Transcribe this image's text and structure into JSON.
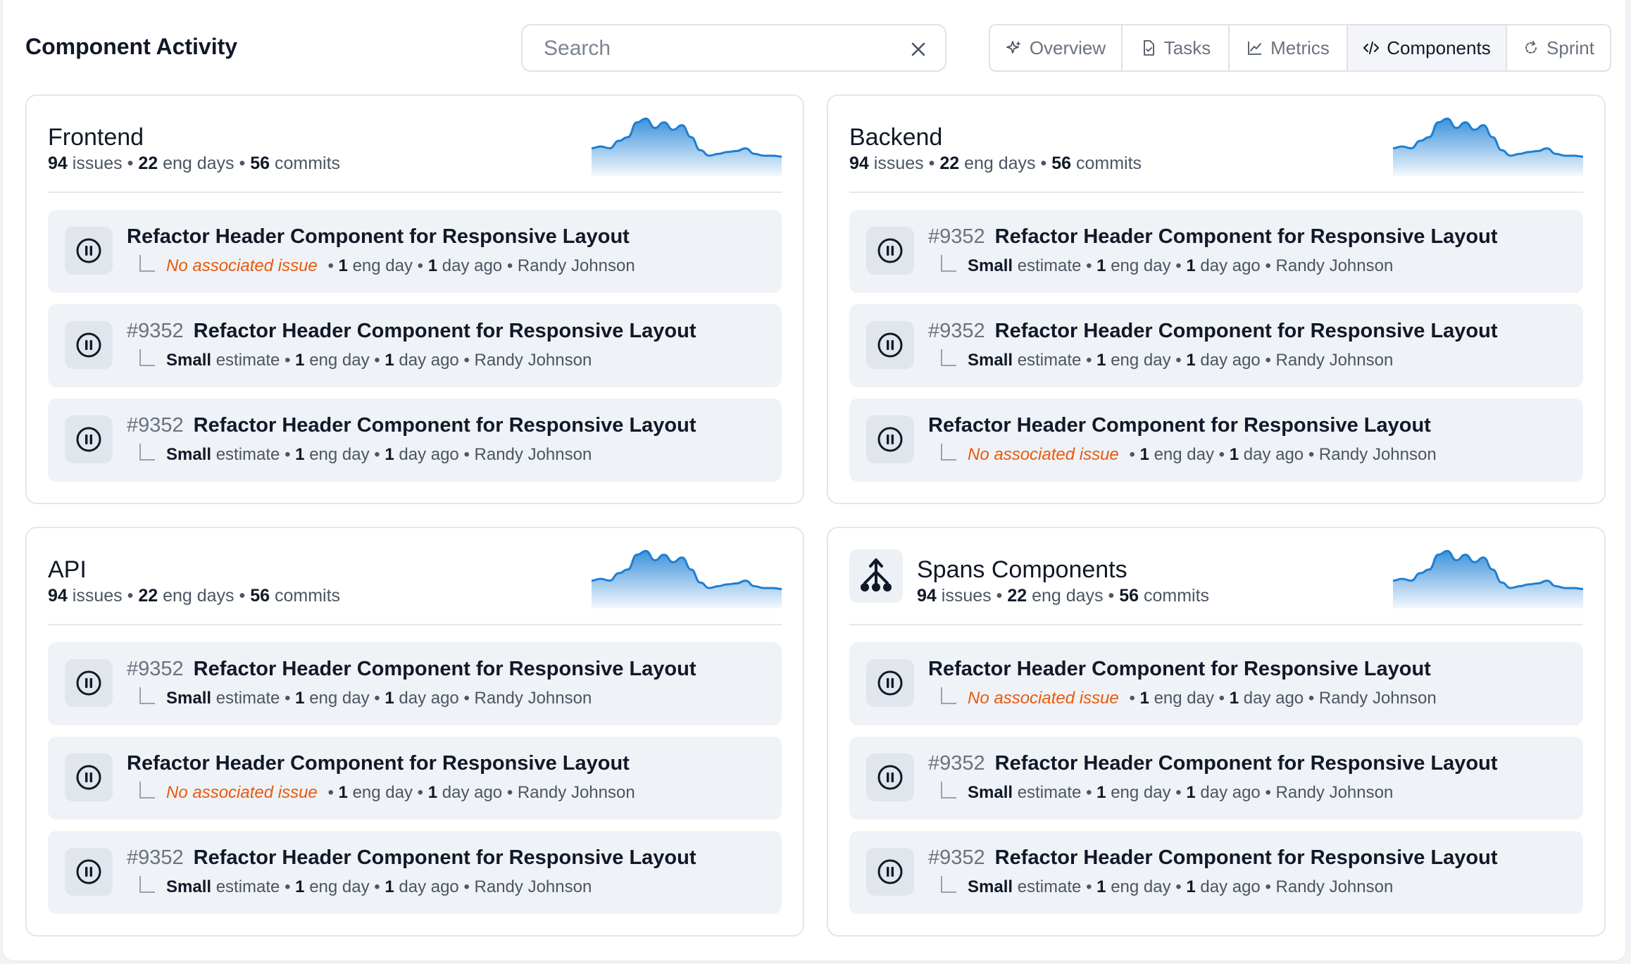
{
  "header": {
    "title": "Component Activity",
    "search_placeholder": "Search",
    "search_value": ""
  },
  "tabs": [
    {
      "label": "Overview",
      "icon": "sparkle-icon",
      "active": false
    },
    {
      "label": "Tasks",
      "icon": "document-icon",
      "active": false
    },
    {
      "label": "Metrics",
      "icon": "chart-line-icon",
      "active": false
    },
    {
      "label": "Components",
      "icon": "code-icon",
      "active": true
    },
    {
      "label": "Sprint",
      "icon": "cycle-icon",
      "active": false
    }
  ],
  "sep": "•",
  "labels": {
    "issues": "issues",
    "eng_days": "eng days",
    "commits": "commits",
    "estimate": "estimate",
    "eng_day": "eng day",
    "day_ago": "day ago",
    "no_issue": "No associated issue"
  },
  "colors": {
    "accent": "#1b7fd4",
    "warning": "#e8590c"
  },
  "sparkline": [
    30,
    32,
    30,
    38,
    42,
    58,
    62,
    52,
    58,
    50,
    55,
    42,
    28,
    22,
    24,
    26,
    27,
    30,
    24,
    22,
    22,
    21
  ],
  "cards": [
    {
      "name": "Frontend",
      "issues": "94",
      "eng_days": "22",
      "commits": "56",
      "items": [
        {
          "issue": "",
          "title": "Refactor Header Component for Responsive Layout",
          "estimate": "",
          "eng": "1",
          "ago": "1",
          "author": "Randy Johnson"
        },
        {
          "issue": "#9352",
          "title": "Refactor Header Component for Responsive Layout",
          "estimate": "Small",
          "eng": "1",
          "ago": "1",
          "author": "Randy Johnson"
        },
        {
          "issue": "#9352",
          "title": "Refactor Header Component for Responsive Layout",
          "estimate": "Small",
          "eng": "1",
          "ago": "1",
          "author": "Randy Johnson"
        }
      ]
    },
    {
      "name": "Backend",
      "issues": "94",
      "eng_days": "22",
      "commits": "56",
      "items": [
        {
          "issue": "#9352",
          "title": "Refactor Header Component for Responsive Layout",
          "estimate": "Small",
          "eng": "1",
          "ago": "1",
          "author": "Randy Johnson"
        },
        {
          "issue": "#9352",
          "title": "Refactor Header Component for Responsive Layout",
          "estimate": "Small",
          "eng": "1",
          "ago": "1",
          "author": "Randy Johnson"
        },
        {
          "issue": "",
          "title": "Refactor Header Component for Responsive Layout",
          "estimate": "",
          "eng": "1",
          "ago": "1",
          "author": "Randy Johnson"
        }
      ]
    },
    {
      "name": "API",
      "issues": "94",
      "eng_days": "22",
      "commits": "56",
      "items": [
        {
          "issue": "#9352",
          "title": "Refactor Header Component for Responsive Layout",
          "estimate": "Small",
          "eng": "1",
          "ago": "1",
          "author": "Randy Johnson"
        },
        {
          "issue": "",
          "title": "Refactor Header Component for Responsive Layout",
          "estimate": "",
          "eng": "1",
          "ago": "1",
          "author": "Randy Johnson"
        },
        {
          "issue": "#9352",
          "title": "Refactor Header Component for Responsive Layout",
          "estimate": "Small",
          "eng": "1",
          "ago": "1",
          "author": "Randy Johnson"
        }
      ]
    },
    {
      "name": "Spans Components",
      "icon": "fork-icon",
      "issues": "94",
      "eng_days": "22",
      "commits": "56",
      "items": [
        {
          "issue": "",
          "title": "Refactor Header Component for Responsive Layout",
          "estimate": "",
          "eng": "1",
          "ago": "1",
          "author": "Randy Johnson"
        },
        {
          "issue": "#9352",
          "title": "Refactor Header Component for Responsive Layout",
          "estimate": "Small",
          "eng": "1",
          "ago": "1",
          "author": "Randy Johnson"
        },
        {
          "issue": "#9352",
          "title": "Refactor Header Component for Responsive Layout",
          "estimate": "Small",
          "eng": "1",
          "ago": "1",
          "author": "Randy Johnson"
        }
      ]
    }
  ]
}
